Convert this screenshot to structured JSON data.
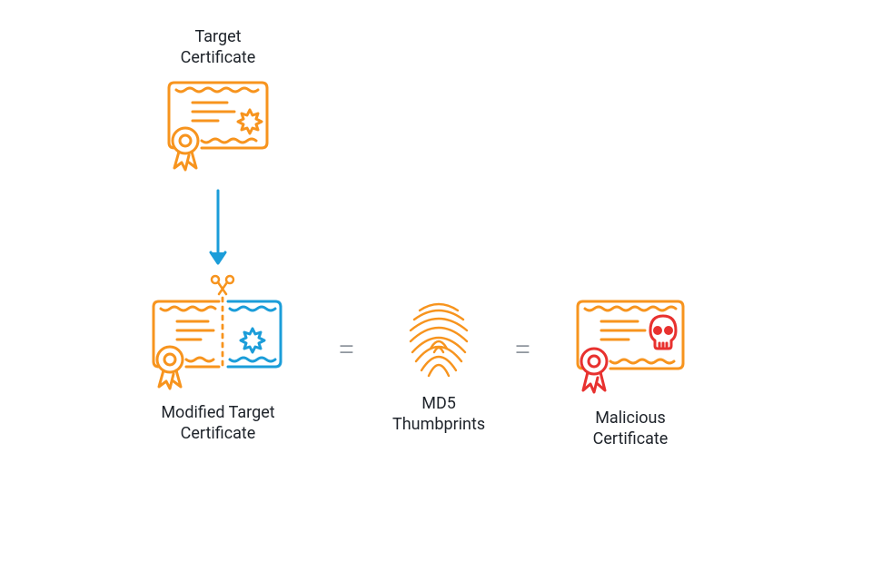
{
  "labels": {
    "target": "Target\nCertificate",
    "modified": "Modified Target\nCertificate",
    "md5": "MD5\nThumbprints",
    "malicious": "Malicious\nCertificate",
    "eq": "="
  },
  "colors": {
    "orange": "#f7941e",
    "blue": "#1b9dd9",
    "red": "#e8312f",
    "gray": "#8f969e",
    "arrow": "#1b9dd9"
  }
}
